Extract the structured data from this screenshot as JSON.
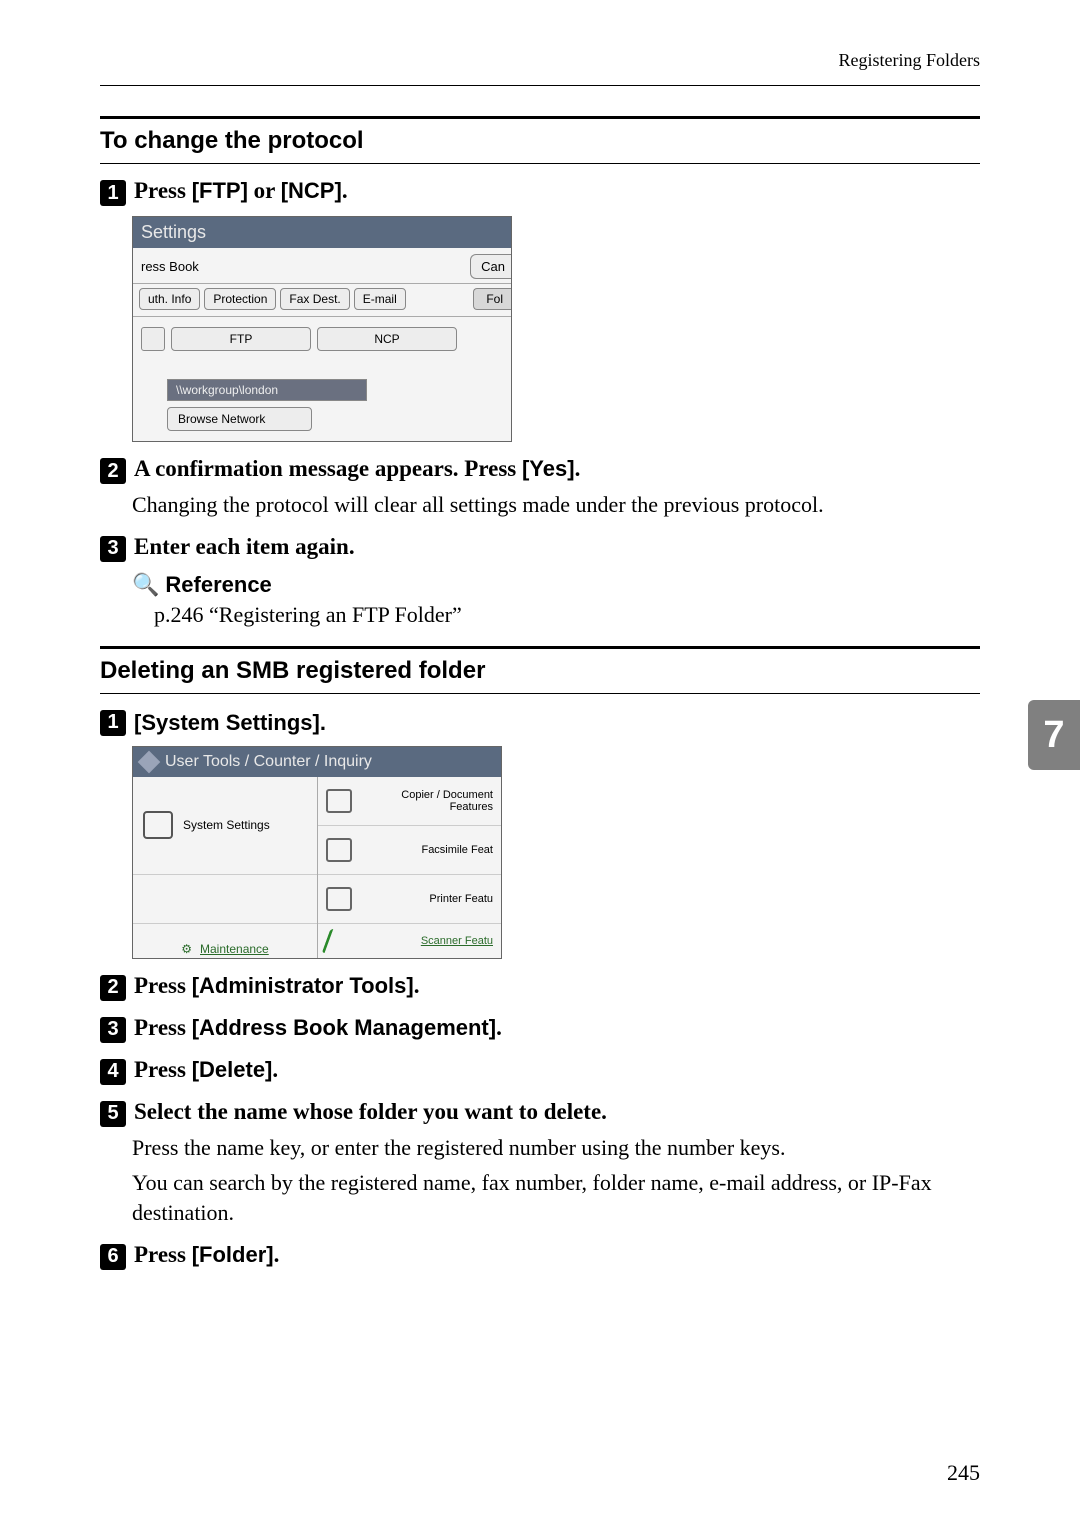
{
  "header": {
    "section": "Registering Folders"
  },
  "side_tab": "7",
  "page_number": "245",
  "sec1": {
    "title": "To change the protocol",
    "step1_prefix": "Press ",
    "step1_b1": "[FTP]",
    "step1_mid": " or ",
    "step1_b2": "[NCP]",
    "step1_suffix": ".",
    "step2_a": "A confirmation message appears. Press ",
    "step2_b": "[Yes]",
    "step2_c": ".",
    "step2_body": "Changing the protocol will clear all settings made under the previous protocol.",
    "step3": "Enter each item again.",
    "ref_label": "Reference",
    "ref_text": "p.246 “Registering an FTP Folder”"
  },
  "scr1": {
    "title": "Settings",
    "ress": "ress Book",
    "can": "Can",
    "tabs": [
      "uth. Info",
      "Protection",
      "Fax Dest.",
      "E-mail"
    ],
    "fol": "Fol",
    "proto": [
      "FTP",
      "NCP"
    ],
    "path": "\\\\workgroup\\london",
    "browse": "Browse Network"
  },
  "sec2": {
    "title": "Deleting an SMB registered folder",
    "step1": "[System Settings].",
    "step2_a": "Press ",
    "step2_b": "[Administrator Tools]",
    "step2_c": ".",
    "step3_a": "Press ",
    "step3_b": "[Address Book Management]",
    "step3_c": ".",
    "step4_a": "Press ",
    "step4_b": "[Delete]",
    "step4_c": ".",
    "step5": "Select the name whose folder you want to delete.",
    "step5_body1": "Press the name key, or enter the registered number using the number keys.",
    "step5_body2": "You can search by the registered name, fax number, folder name, e-mail address, or IP-Fax destination.",
    "step6_a": "Press ",
    "step6_b": "[Folder]",
    "step6_c": "."
  },
  "scr2": {
    "title": "User Tools / Counter / Inquiry",
    "left": "System Settings",
    "maint": "Maintenance",
    "r1": "Copier / Document Features",
    "r2": "Facsimile Feat",
    "r3": "Printer Featu",
    "r4": "Scanner Featu"
  }
}
